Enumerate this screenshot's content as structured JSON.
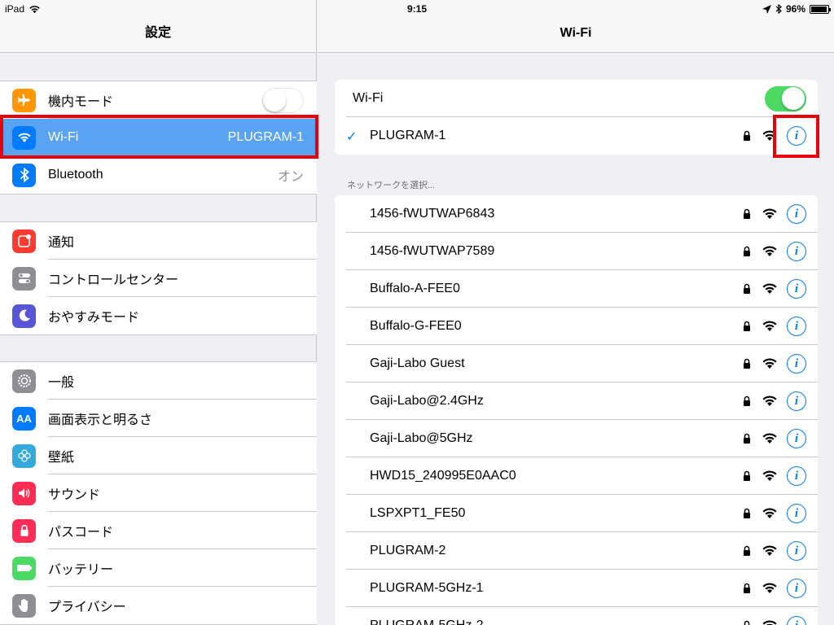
{
  "status_bar": {
    "device": "iPad",
    "time": "9:15",
    "battery": "96%",
    "battery_level": 0.96
  },
  "left": {
    "title": "設定",
    "groups": [
      [
        {
          "label": "機内モード",
          "icon": "airplane-icon",
          "color": "#ff9500",
          "toggle": false
        },
        {
          "label": "Wi-Fi",
          "icon": "wifi-icon",
          "color": "#007aff",
          "value": "PLUGRAM-1",
          "selected": true
        },
        {
          "label": "Bluetooth",
          "icon": "bluetooth-icon",
          "color": "#007aff",
          "value": "オン"
        }
      ],
      [
        {
          "label": "通知",
          "icon": "notifications-icon",
          "color": "#ff3b30"
        },
        {
          "label": "コントロールセンター",
          "icon": "control-center-icon",
          "color": "#8e8e93"
        },
        {
          "label": "おやすみモード",
          "icon": "moon-icon",
          "color": "#5856d6"
        }
      ],
      [
        {
          "label": "一般",
          "icon": "gear-icon",
          "color": "#8e8e93"
        },
        {
          "label": "画面表示と明るさ",
          "icon": "display-icon",
          "color": "#007aff"
        },
        {
          "label": "壁紙",
          "icon": "wallpaper-icon",
          "color": "#34aadc"
        },
        {
          "label": "サウンド",
          "icon": "sound-icon",
          "color": "#ff2d55"
        },
        {
          "label": "パスコード",
          "icon": "passcode-icon",
          "color": "#ff2d55"
        },
        {
          "label": "バッテリー",
          "icon": "battery-icon",
          "color": "#4cd964"
        },
        {
          "label": "プライバシー",
          "icon": "privacy-hand-icon",
          "color": "#8e8e93"
        }
      ]
    ]
  },
  "right": {
    "title": "Wi-Fi",
    "wifi_label": "Wi-Fi",
    "wifi_on": true,
    "connected": "PLUGRAM-1",
    "section_label": "ネットワークを選択...",
    "networks": [
      "1456-fWUTWAP6843",
      "1456-fWUTWAP7589",
      "Buffalo-A-FEE0",
      "Buffalo-G-FEE0",
      "Gaji-Labo Guest",
      "Gaji-Labo@2.4GHz",
      "Gaji-Labo@5GHz",
      "HWD15_240995E0AAC0",
      "LSPXPT1_FE50",
      "PLUGRAM-2",
      "PLUGRAM-5GHz-1",
      "PLUGRAM-5GHz-2"
    ],
    "accent_color": "#007aff",
    "highlight_color": "#e8000b"
  }
}
